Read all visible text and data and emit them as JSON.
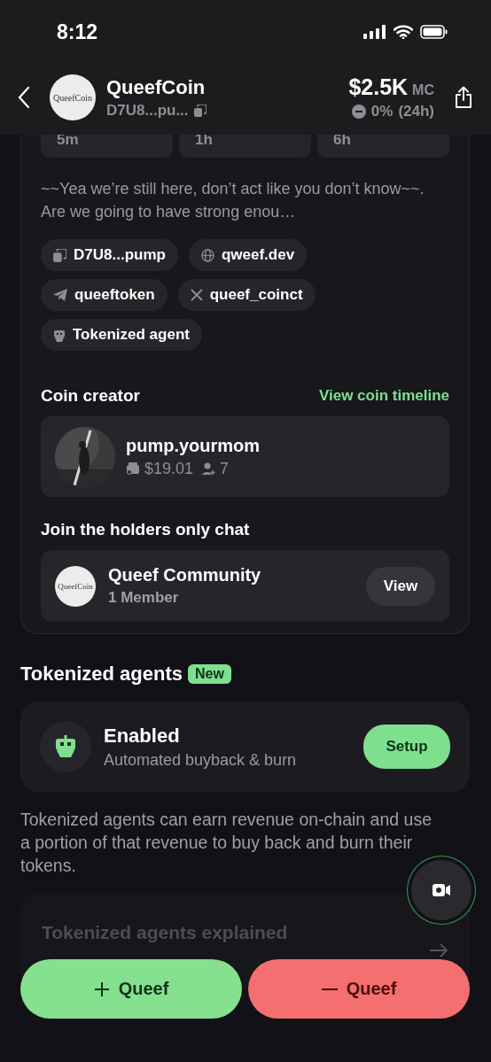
{
  "status_bar": {
    "time": "8:12"
  },
  "header": {
    "name": "QueefCoin",
    "logo_text": "QueefCoin",
    "address": "D7U8...pu...",
    "market_cap": "$2.5K",
    "mc_label": "MC",
    "change": "0%",
    "period": "(24h)"
  },
  "timeframes": [
    {
      "label": "5m"
    },
    {
      "label": "1h"
    },
    {
      "label": "6h"
    }
  ],
  "description": "~~Yea we’re still here, don’t act like you don’t know~~.       Are we going to have strong enou…",
  "links": [
    {
      "kind": "copy",
      "label": "D7U8...pump"
    },
    {
      "kind": "web",
      "label": "qweef.dev"
    },
    {
      "kind": "telegram",
      "label": "queeftoken"
    },
    {
      "kind": "x",
      "label": "queef_coinct"
    },
    {
      "kind": "agent",
      "label": "Tokenized agent"
    }
  ],
  "creator": {
    "title": "Coin creator",
    "link": "View coin timeline",
    "name": "pump.yourmom",
    "balance": "$19.01",
    "followers": "7"
  },
  "chat": {
    "title": "Join the holders only chat",
    "name": "Queef Community",
    "logo_text": "QueefCoin",
    "members": "1 Member",
    "button": "View"
  },
  "agents": {
    "title": "Tokenized agents",
    "badge": "New",
    "status": "Enabled",
    "subtitle": "Automated buyback & burn",
    "button": "Setup",
    "description": "Tokenized agents can earn revenue on-chain and use a portion of that revenue to buy back and burn their tokens.",
    "explained": "Tokenized agents explained"
  },
  "actions": [
    {
      "kind": "buy",
      "label": "Queef"
    },
    {
      "kind": "sell",
      "label": "Queef"
    }
  ]
}
